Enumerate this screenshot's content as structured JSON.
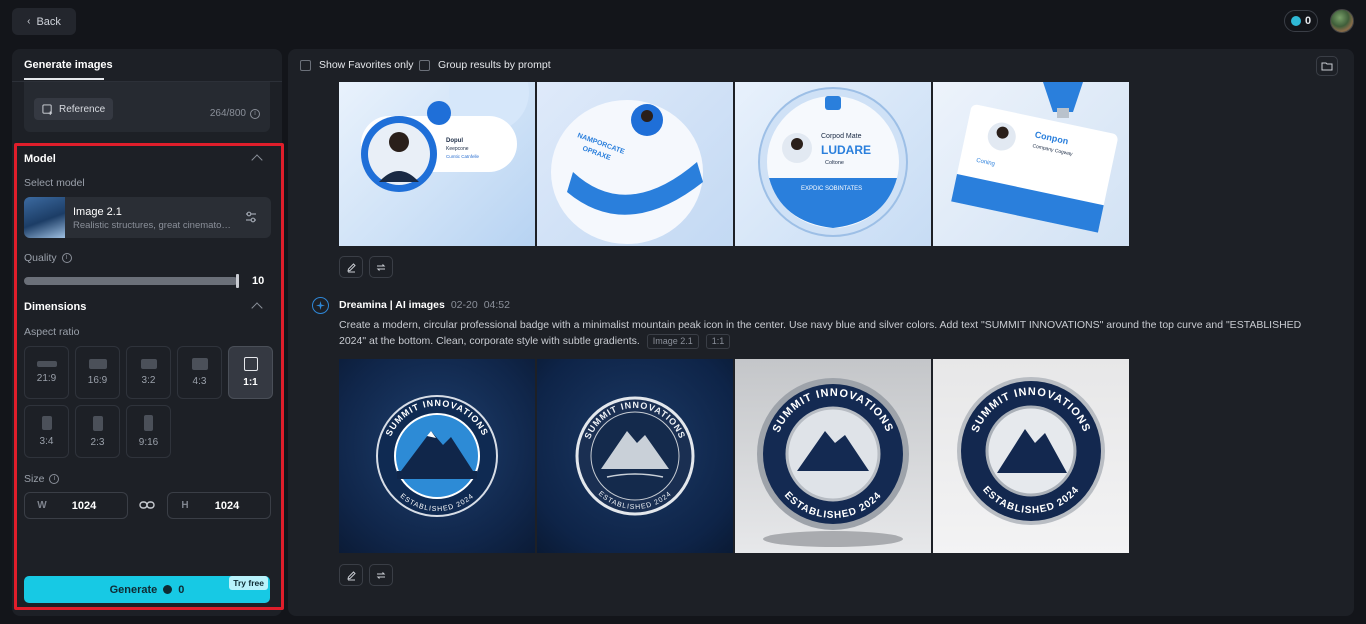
{
  "topbar": {
    "back_label": "Back",
    "credits": "0"
  },
  "left_panel": {
    "tab_label": "Generate images",
    "reference_label": "Reference",
    "char_count": "264/800",
    "model_section": {
      "title": "Model",
      "select_label": "Select model",
      "model_name": "Image 2.1",
      "model_desc": "Realistic structures, great cinematog...",
      "quality_label": "Quality",
      "quality_value": "10",
      "quality_fraction": 1.0
    },
    "dimensions_section": {
      "title": "Dimensions",
      "aspect_label": "Aspect ratio",
      "ratios": [
        "21:9",
        "16:9",
        "3:2",
        "4:3",
        "1:1",
        "3:4",
        "2:3",
        "9:16"
      ],
      "selected_ratio": "1:1",
      "size_label": "Size",
      "width_prefix": "W",
      "width_value": "1024",
      "height_prefix": "H",
      "height_value": "1024"
    },
    "generate_label": "Generate",
    "generate_credits": "0",
    "try_free_label": "Try free"
  },
  "right_panel": {
    "show_favorites_label": "Show Favorites only",
    "group_results_label": "Group results by prompt",
    "generation": {
      "author": "Dreamina | AI images",
      "date": "02-20",
      "time": "04:52",
      "prompt": "Create a modern, circular professional badge with a minimalist mountain peak icon in the center. Use navy blue and silver colors. Add text \"SUMMIT INNOVATIONS\" around the top curve and \"ESTABLISHED 2024\" at the bottom. Clean, corporate style with subtle gradients.",
      "model_tag": "Image 2.1",
      "ratio_tag": "1:1"
    },
    "top_images_text": {
      "img1_name": "Dopul",
      "img1_sub": "Keepcone",
      "img1_line": "Cumtic Catnfelle",
      "img2_top": "NAMPORCATE",
      "img2_bottom": "OPRAXE",
      "img3_title": "Corpod Mate",
      "img3_big": "LUDARE",
      "img3_sub": "Coltone",
      "img3_bottom": "EXPDIC SOBINTATES",
      "img4_title": "Conpon",
      "img4_sub": "Company Cogway",
      "img4_left": "Coning"
    },
    "badge_text": {
      "top": "SUMMIT INNOVATIONS",
      "bottom": "ESTABLISHED 2024"
    }
  },
  "colors": {
    "accent": "#17c9e4",
    "highlight": "#e01e2b",
    "background": "#13151a",
    "panel": "#1d2026"
  }
}
